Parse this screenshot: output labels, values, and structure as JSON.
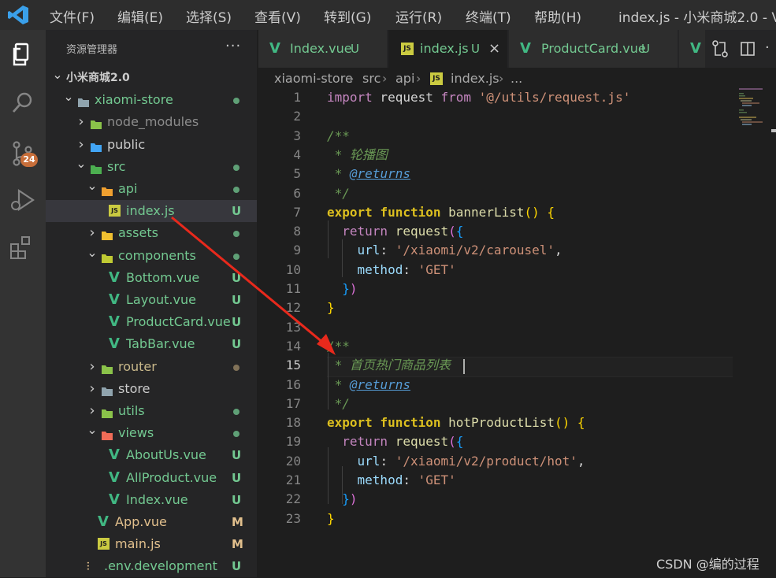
{
  "titlebar": {
    "menus": [
      "文件(F)",
      "编辑(E)",
      "选择(S)",
      "查看(V)",
      "转到(G)",
      "运行(R)",
      "终端(T)",
      "帮助(H)"
    ],
    "window_title": "index.js - 小米商城2.0 - V"
  },
  "activity_bar": {
    "items": [
      "explorer-icon",
      "search-icon",
      "source-control-icon",
      "run-debug-icon",
      "extensions-icon"
    ],
    "scm_badge": "24"
  },
  "sidebar": {
    "header": "资源管理器",
    "more": "···",
    "tree": [
      {
        "label": "小米商城2.0",
        "kind": "root",
        "expanded": true,
        "status": ""
      },
      {
        "label": "xiaomi-store",
        "kind": "folder",
        "expanded": true,
        "status": "dot"
      },
      {
        "label": "node_modules",
        "kind": "folder",
        "expanded": false,
        "status": ""
      },
      {
        "label": "public",
        "kind": "folder",
        "expanded": false,
        "status": ""
      },
      {
        "label": "src",
        "kind": "folder",
        "expanded": true,
        "status": "dot"
      },
      {
        "label": "api",
        "kind": "folder",
        "expanded": true,
        "status": "dot"
      },
      {
        "label": "index.js",
        "kind": "js",
        "status": "U",
        "selected": true
      },
      {
        "label": "assets",
        "kind": "folder",
        "expanded": false,
        "status": "dot"
      },
      {
        "label": "components",
        "kind": "folder",
        "expanded": true,
        "status": "dot"
      },
      {
        "label": "Bottom.vue",
        "kind": "vue",
        "status": "U"
      },
      {
        "label": "Layout.vue",
        "kind": "vue",
        "status": "U"
      },
      {
        "label": "ProductCard.vue",
        "kind": "vue",
        "status": "U"
      },
      {
        "label": "TabBar.vue",
        "kind": "vue",
        "status": "U"
      },
      {
        "label": "router",
        "kind": "folder",
        "expanded": false,
        "status": "dot-brown"
      },
      {
        "label": "store",
        "kind": "folder",
        "expanded": false,
        "status": ""
      },
      {
        "label": "utils",
        "kind": "folder",
        "expanded": false,
        "status": "dot"
      },
      {
        "label": "views",
        "kind": "folder",
        "expanded": true,
        "status": "dot"
      },
      {
        "label": "AboutUs.vue",
        "kind": "vue",
        "status": "U"
      },
      {
        "label": "AllProduct.vue",
        "kind": "vue",
        "status": "U"
      },
      {
        "label": "Index.vue",
        "kind": "vue",
        "status": "U"
      },
      {
        "label": "App.vue",
        "kind": "vue",
        "status": "M"
      },
      {
        "label": "main.js",
        "kind": "js",
        "status": "M"
      },
      {
        "label": ".env.development",
        "kind": "env",
        "status": "U"
      }
    ]
  },
  "tabs": [
    {
      "label": "Index.vue",
      "kind": "vue",
      "status": "U",
      "active": false
    },
    {
      "label": "index.js",
      "kind": "js",
      "status": "U",
      "active": true,
      "close": "×"
    },
    {
      "label": "ProductCard.vue",
      "kind": "vue",
      "status": "U",
      "active": false
    }
  ],
  "breadcrumb": [
    "xiaomi-store",
    "src",
    "api",
    "index.js",
    "..."
  ],
  "editor": {
    "current_line": 15,
    "lines": [
      [
        [
          "kw",
          "import"
        ],
        [
          "txt",
          " request "
        ],
        [
          "kw",
          "from"
        ],
        [
          "txt",
          " "
        ],
        [
          "str",
          "'@/utils/request.js'"
        ]
      ],
      [],
      [
        [
          "cmt",
          "/**"
        ]
      ],
      [
        [
          "cmt",
          " * 轮播图"
        ]
      ],
      [
        [
          "cmt",
          " * "
        ],
        [
          "tag",
          "@returns"
        ]
      ],
      [
        [
          "cmt",
          " */"
        ]
      ],
      [
        [
          "kw2",
          "export"
        ],
        [
          "txt",
          " "
        ],
        [
          "kw2",
          "function"
        ],
        [
          "txt",
          " "
        ],
        [
          "fn",
          "bannerList"
        ],
        [
          "paren1",
          "()"
        ],
        [
          "txt",
          " "
        ],
        [
          "paren1",
          "{"
        ]
      ],
      [
        [
          "txt",
          "  "
        ],
        [
          "kw",
          "return"
        ],
        [
          "txt",
          " "
        ],
        [
          "fn",
          "request"
        ],
        [
          "paren2",
          "("
        ],
        [
          "paren3",
          "{"
        ]
      ],
      [
        [
          "txt",
          "    "
        ],
        [
          "prop",
          "url"
        ],
        [
          "txt",
          ": "
        ],
        [
          "str",
          "'/xiaomi/v2/carousel'"
        ],
        [
          "txt",
          ","
        ]
      ],
      [
        [
          "txt",
          "    "
        ],
        [
          "prop",
          "method"
        ],
        [
          "txt",
          ": "
        ],
        [
          "str",
          "'GET'"
        ]
      ],
      [
        [
          "txt",
          "  "
        ],
        [
          "paren3",
          "}"
        ],
        [
          "paren2",
          ")"
        ]
      ],
      [
        [
          "paren1",
          "}"
        ]
      ],
      [],
      [
        [
          "cmt",
          "/**"
        ]
      ],
      [
        [
          "cmt",
          " * 首页热门商品列表"
        ]
      ],
      [
        [
          "cmt",
          " * "
        ],
        [
          "tag",
          "@returns"
        ]
      ],
      [
        [
          "cmt",
          " */"
        ]
      ],
      [
        [
          "kw2",
          "export"
        ],
        [
          "txt",
          " "
        ],
        [
          "kw2",
          "function"
        ],
        [
          "txt",
          " "
        ],
        [
          "fn",
          "hotProductList"
        ],
        [
          "paren1",
          "()"
        ],
        [
          "txt",
          " "
        ],
        [
          "paren1",
          "{"
        ]
      ],
      [
        [
          "txt",
          "  "
        ],
        [
          "kw",
          "return"
        ],
        [
          "txt",
          " "
        ],
        [
          "fn",
          "request"
        ],
        [
          "paren2",
          "("
        ],
        [
          "paren3",
          "{"
        ]
      ],
      [
        [
          "txt",
          "    "
        ],
        [
          "prop",
          "url"
        ],
        [
          "txt",
          ": "
        ],
        [
          "str",
          "'/xiaomi/v2/product/hot'"
        ],
        [
          "txt",
          ","
        ]
      ],
      [
        [
          "txt",
          "    "
        ],
        [
          "prop",
          "method"
        ],
        [
          "txt",
          ": "
        ],
        [
          "str",
          "'GET'"
        ]
      ],
      [
        [
          "txt",
          "  "
        ],
        [
          "paren3",
          "}"
        ],
        [
          "paren2",
          ")"
        ]
      ],
      [
        [
          "paren1",
          "}"
        ]
      ]
    ]
  },
  "watermark": "CSDN @编的过程",
  "colors": {
    "vue": "#41b883",
    "js": "#cbcb41",
    "git_untracked": "#73c991",
    "git_modified": "#e2c08d",
    "annotation_arrow": "#e8291c"
  }
}
